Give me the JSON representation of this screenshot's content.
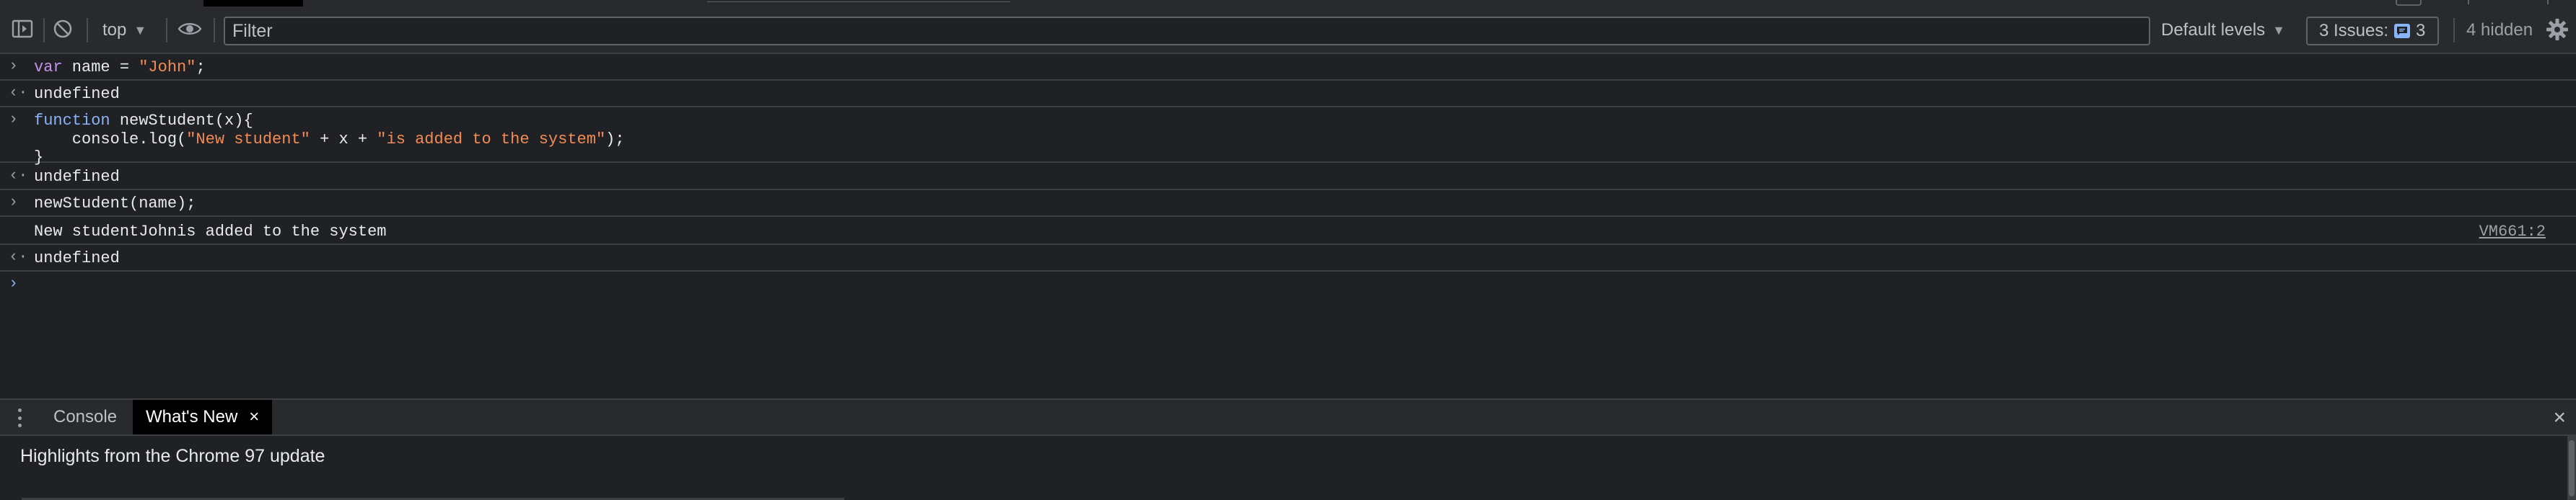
{
  "toolbar": {
    "context": "top",
    "filter_placeholder": "Filter",
    "levels_label": "Default levels",
    "issues_label": "3 Issues:",
    "issues_count": "3",
    "hidden_label": "4 hidden"
  },
  "console": {
    "line1": {
      "kw": "var",
      "ident": " name = ",
      "str": "\"John\"",
      "tail": ";"
    },
    "result1": "undefined",
    "line2": {
      "kw": "function",
      "ident": " newStudent(x){"
    },
    "line3": {
      "pre": "    console.log(",
      "str1": "\"New student\"",
      "mid": " + x + ",
      "str2": "\"is added to the system\"",
      "tail": ");"
    },
    "line4": "}",
    "result2": "undefined",
    "line5": "newStudent(name);",
    "log_text": "New studentJohnis added to the system",
    "log_source": "VM661:2",
    "result3": "undefined"
  },
  "drawer": {
    "tabs": [
      {
        "label": "Console"
      },
      {
        "label": "What's New"
      }
    ],
    "close_symbol": "×",
    "whats_new_title": "Highlights from the Chrome 97 update"
  },
  "colors": {
    "background": "#202124",
    "toolbar": "#292a2d",
    "keyword": "#c792ea",
    "string": "#f28b54",
    "accent": "#8ab4f8"
  }
}
